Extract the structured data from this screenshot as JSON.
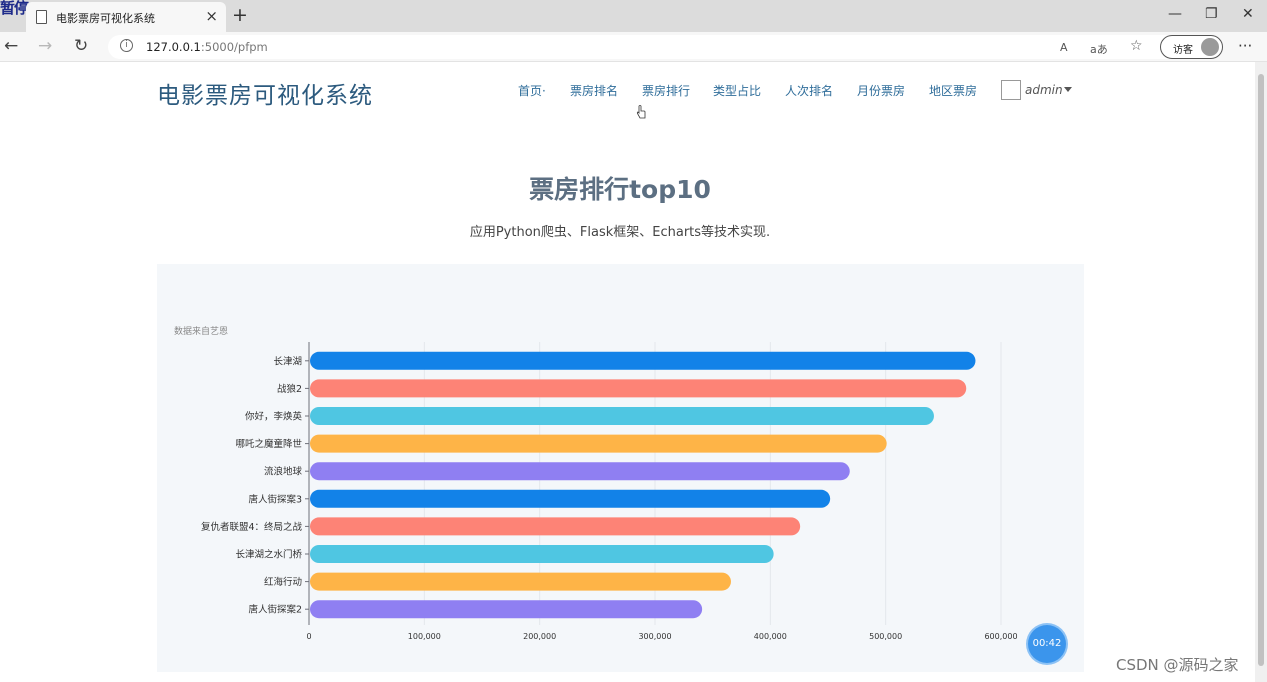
{
  "browser": {
    "overlay_text": "暂停",
    "tab_title": "电影票房可视化系统",
    "url_host": "127.0.0.1",
    "url_path": ":5000/pfpm",
    "read_aloud_label": "A",
    "translate_label": "aあ",
    "guest_label": "访客"
  },
  "site": {
    "brand": "电影票房可视化系统",
    "menu": [
      "首页·",
      "票房排名",
      "票房排行",
      "类型占比",
      "人次排名",
      "月份票房",
      "地区票房"
    ],
    "user": "admin"
  },
  "section": {
    "title": "票房排行top10",
    "subtitle": "应用Python爬虫、Flask框架、Echarts等技术实现."
  },
  "chart_data": {
    "type": "bar",
    "orientation": "horizontal",
    "subtext": "数据来自艺恩",
    "categories": [
      "长津湖",
      "战狼2",
      "你好，李焕英",
      "哪吒之魔童降世",
      "流浪地球",
      "唐人街探案3",
      "复仇者联盟4：终局之战",
      "长津湖之水门桥",
      "红海行动",
      "唐人街探案2"
    ],
    "values": [
      577000,
      569000,
      541000,
      500000,
      468000,
      451000,
      425000,
      402000,
      365000,
      340000
    ],
    "xlim": [
      0,
      600000
    ],
    "xticks": [
      "0",
      "100,000",
      "200,000",
      "300,000",
      "400,000",
      "500,000",
      "600,000"
    ],
    "grid": true,
    "colors": [
      "#1282e8",
      "#fd8376",
      "#4fc6e2",
      "#feb447",
      "#8f7ff2"
    ]
  },
  "overlay": {
    "timer": "00:42",
    "watermark": "CSDN @源码之家"
  }
}
